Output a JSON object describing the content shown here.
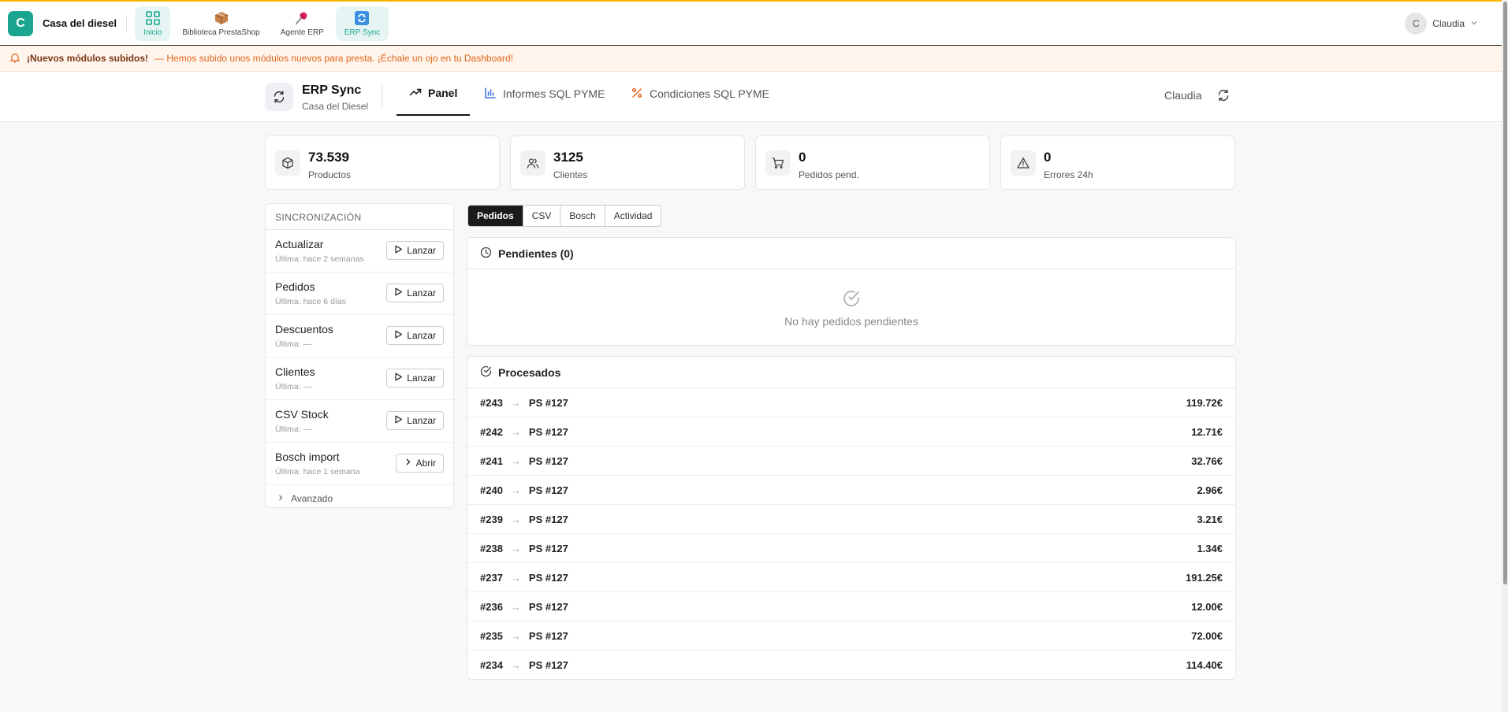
{
  "topbar": {
    "brand_initial": "C",
    "brand_name": "Casa del diesel",
    "apps": [
      {
        "label": "Inicio",
        "icon": "grid-icon"
      },
      {
        "label": "Biblioteca PrestaShop",
        "icon": "package-icon"
      },
      {
        "label": "Agente ERP",
        "icon": "pin-icon"
      },
      {
        "label": "ERP Sync",
        "icon": "sync-icon"
      }
    ],
    "user_initial": "C",
    "user_name": "Claudia"
  },
  "notice": {
    "title": "¡Nuevos módulos subidos!",
    "message": "— Hemos subido unos módulos nuevos para presta. ¡Échale un ojo en tu Dashboard!"
  },
  "erp": {
    "title": "ERP Sync",
    "subtitle": "Casa del Diesel",
    "tabs": [
      {
        "label": "Panel",
        "icon": "trend-icon"
      },
      {
        "label": "Informes SQL PYME",
        "icon": "bar-chart-icon"
      },
      {
        "label": "Condiciones SQL PYME",
        "icon": "percent-icon"
      }
    ],
    "user": "Claudia"
  },
  "stats": [
    {
      "value": "73.539",
      "label": "Productos",
      "icon": "box-icon"
    },
    {
      "value": "3125",
      "label": "Clientes",
      "icon": "users-icon"
    },
    {
      "value": "0",
      "label": "Pedidos pend.",
      "icon": "cart-icon"
    },
    {
      "value": "0",
      "label": "Errores 24h",
      "icon": "alert-icon"
    }
  ],
  "sync": {
    "heading": "SINCRONIZACIÓN",
    "items": [
      {
        "name": "Actualizar",
        "last": "Última: hace 2 semanas",
        "action": "Lanzar"
      },
      {
        "name": "Pedidos",
        "last": "Última: hace 6 días",
        "action": "Lanzar"
      },
      {
        "name": "Descuentos",
        "last": "Última: —",
        "action": "Lanzar"
      },
      {
        "name": "Clientes",
        "last": "Última: —",
        "action": "Lanzar"
      },
      {
        "name": "CSV Stock",
        "last": "Última: —",
        "action": "Lanzar"
      },
      {
        "name": "Bosch import",
        "last": "Última: hace 1 semana",
        "action": "Abrir"
      }
    ],
    "advanced": "Avanzado"
  },
  "subtabs": [
    "Pedidos",
    "CSV",
    "Bosch",
    "Actividad"
  ],
  "pending": {
    "title": "Pendientes (0)",
    "empty": "No hay pedidos pendientes"
  },
  "processed": {
    "title": "Procesados",
    "rows": [
      {
        "id": "#243",
        "ps": "PS #127",
        "total": "119.72€"
      },
      {
        "id": "#242",
        "ps": "PS #127",
        "total": "12.71€"
      },
      {
        "id": "#241",
        "ps": "PS #127",
        "total": "32.76€"
      },
      {
        "id": "#240",
        "ps": "PS #127",
        "total": "2.96€"
      },
      {
        "id": "#239",
        "ps": "PS #127",
        "total": "3.21€"
      },
      {
        "id": "#238",
        "ps": "PS #127",
        "total": "1.34€"
      },
      {
        "id": "#237",
        "ps": "PS #127",
        "total": "191.25€"
      },
      {
        "id": "#236",
        "ps": "PS #127",
        "total": "12.00€"
      },
      {
        "id": "#235",
        "ps": "PS #127",
        "total": "72.00€"
      },
      {
        "id": "#234",
        "ps": "PS #127",
        "total": "114.40€"
      }
    ],
    "arrow": "→"
  },
  "colors": {
    "brand": "#1aa58f",
    "accent_top": "#f5b400",
    "notice_text": "#e0651b",
    "active_tab": "#1a1a1a"
  }
}
